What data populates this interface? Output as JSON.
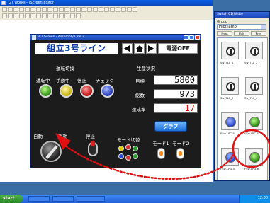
{
  "editor": {
    "title": "GT Works - [Screen Editor]"
  },
  "hmi_window": {
    "title": "B-1 Screen - Assembly Line 3"
  },
  "hmi": {
    "line_title": "組立3号ライン",
    "power_off": "電源OFF",
    "run_switch_header": "運転切換",
    "status_labels": [
      "運転中",
      "手動中",
      "停止",
      "チェック"
    ],
    "lamp_colors": [
      "#2c8a12",
      "#c6b00a",
      "#b80f0f",
      "#1e34b4"
    ],
    "production_header": "生産状況",
    "target_label": "目標",
    "target_value": "5800",
    "total_label": "総数",
    "total_value": "973",
    "rate_label": "達成率",
    "rate_value": "17",
    "graph_button": "グラフ",
    "auto_label": "自動",
    "manual_label": "手動",
    "stop_label": "停止",
    "mode_switch_label": "モード切替",
    "mode1_label": "モード1",
    "mode2_label": "モード2",
    "mode_dot_colors": [
      "#e3d000",
      "#d83030",
      "#2a9a2a",
      "#2a4ad0",
      "#d83030",
      "#2a9a2a"
    ]
  },
  "palette": {
    "title": "Switch 01(Wide)",
    "group_label": "Group",
    "group_value": "Pilot lamp",
    "buttons": [
      "Next",
      "Edit",
      "Prev"
    ],
    "items": [
      {
        "caption": "Sw_TLL_1",
        "kind": "switch"
      },
      {
        "caption": "Sw_TLL_2",
        "kind": "switch"
      },
      {
        "caption": "Sw_TLL_3",
        "kind": "switch"
      },
      {
        "caption": "Sw_TLL_4",
        "kind": "switch"
      },
      {
        "caption": "FSw-LPC-5",
        "kind": "lamp",
        "color": "#2a4ad0"
      },
      {
        "caption": "FSw-LPC-6",
        "kind": "lamp",
        "color": "#2c8a12"
      },
      {
        "caption": "FSw-LPD-5",
        "kind": "lamp",
        "color": "#2a4ad0"
      },
      {
        "caption": "FSw-LPD-6",
        "kind": "lamp",
        "color": "#2c8a12"
      }
    ]
  },
  "taskbar": {
    "start_label": "start",
    "tray_time": "12:00"
  },
  "annotation": {
    "arrow_color": "#e01010",
    "highlight_color": "#e01010"
  }
}
